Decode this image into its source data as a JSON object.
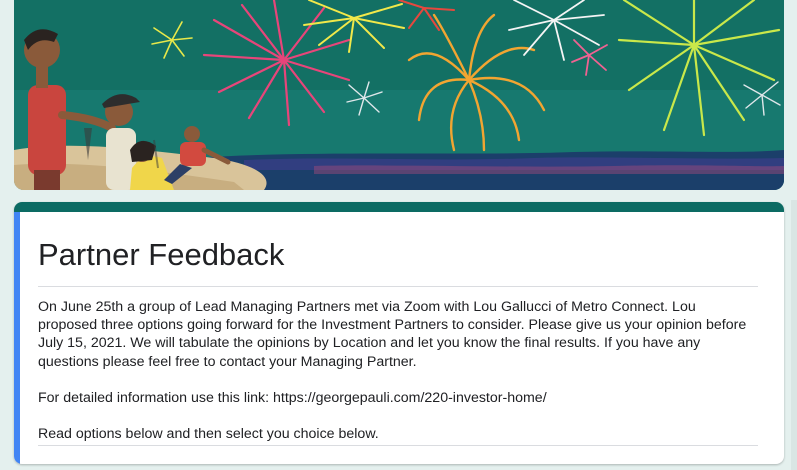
{
  "form": {
    "title": "Partner Feedback",
    "description_paragraphs": [
      "On June 25th a group of Lead Managing Partners met via Zoom with Lou Gallucci of Metro Connect.  Lou proposed three options going forward for the Investment Partners to consider.  Please give us your opinion before July 15, 2021.  We will tabulate the opinions by Location and let you know the final results.  If you have any questions please feel free to contact your Managing Partner.",
      "For detailed information use this link: https://georgepauli.com/220-investor-home/",
      "Read options below and then select you choice below."
    ]
  },
  "theme": {
    "header_color": "#0c6b63",
    "accent_bar_color": "#4285f4",
    "background_color": "#e4f0ee",
    "banner_sky_color": "#16796e"
  },
  "banner": {
    "image": "fireworks-beach-illustration"
  }
}
